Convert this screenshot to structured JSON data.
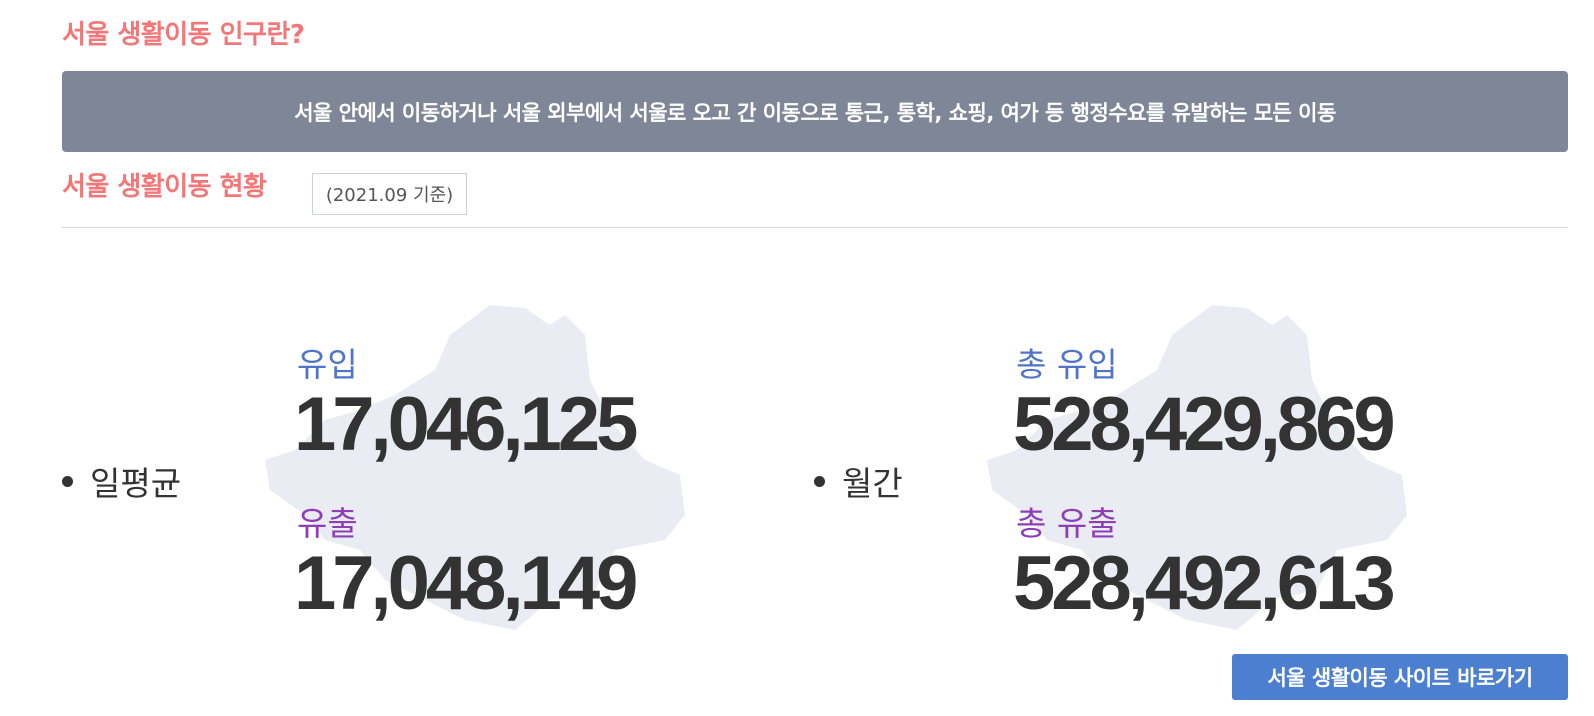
{
  "intro": {
    "title": "서울 생활이동 인구란?",
    "definition": "서울 안에서 이동하거나 서울 외부에서 서울로 오고 간 이동으로 통근, 통학, 쇼핑, 여가 등 행정수요를 유발하는 모든 이동"
  },
  "status": {
    "title": "서울 생활이동 현황",
    "basis": "(2021.09 기준)"
  },
  "daily": {
    "label": "일평균",
    "inflow_label": "유입",
    "inflow_value": "17,046,125",
    "outflow_label": "유출",
    "outflow_value": "17,048,149"
  },
  "monthly": {
    "label": "월간",
    "inflow_label": "총 유입",
    "inflow_value": "528,429,869",
    "outflow_label": "총 유출",
    "outflow_value": "528,492,613"
  },
  "actions": {
    "site_button": "서울 생활이동 사이트 바로가기"
  },
  "colors": {
    "title": "#f37778",
    "definition_bg": "#7e8698",
    "inflow": "#4f74c9",
    "outflow": "#8e3fb6",
    "button": "#4c7fcf"
  },
  "icons": {
    "background": "seoul-map-silhouette"
  }
}
